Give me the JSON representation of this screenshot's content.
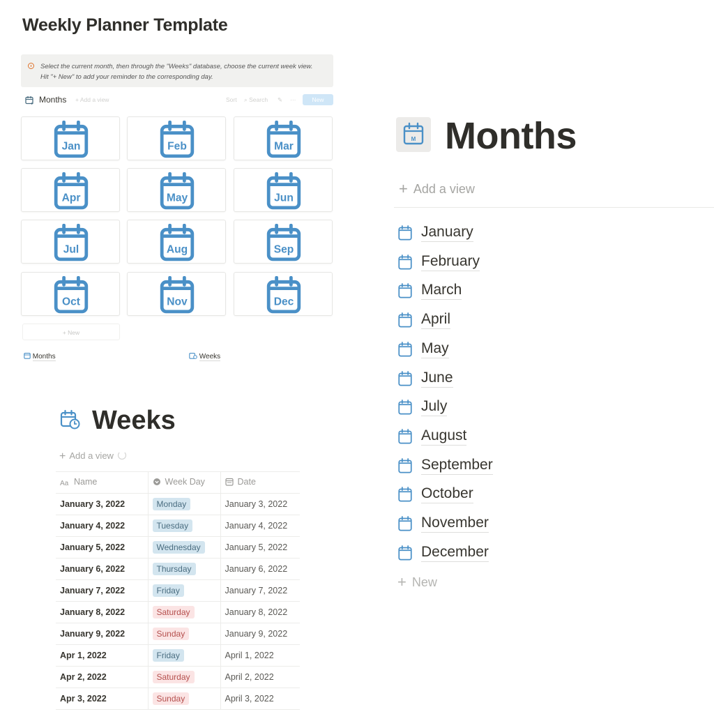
{
  "template": {
    "title": "Weekly Planner Template",
    "callout_line1": "Select the current month, then through the \"Weeks\" database, choose the current week view.",
    "callout_line2": "Hit \"+ New\" to add your reminder to the corresponding day.",
    "db_title": "Months",
    "db_add_view": "Add a view",
    "db_sort": "Sort",
    "db_search": "Search",
    "db_new": "New",
    "gallery": [
      "Jan",
      "Feb",
      "Mar",
      "Apr",
      "May",
      "Jun",
      "Jul",
      "Aug",
      "Sep",
      "Oct",
      "Nov",
      "Dec"
    ],
    "gallery_new": "+ New",
    "link_months": "Months",
    "link_weeks": "Weeks"
  },
  "months_page": {
    "title": "Months",
    "add_view": "Add a view",
    "items": [
      "January",
      "February",
      "March",
      "April",
      "May",
      "June",
      "July",
      "August",
      "September",
      "October",
      "November",
      "December"
    ],
    "new": "New"
  },
  "weeks_page": {
    "title": "Weeks",
    "add_view": "Add a view",
    "columns": [
      "Name",
      "Week Day",
      "Date"
    ],
    "rows": [
      {
        "name": "January 3, 2022",
        "day": "Monday",
        "color": "blue",
        "date": "January 3, 2022"
      },
      {
        "name": "January 4, 2022",
        "day": "Tuesday",
        "color": "blue",
        "date": "January 4, 2022"
      },
      {
        "name": "January 5, 2022",
        "day": "Wednesday",
        "color": "blue",
        "date": "January 5, 2022"
      },
      {
        "name": "January 6, 2022",
        "day": "Thursday",
        "color": "blue",
        "date": "January 6, 2022"
      },
      {
        "name": "January 7, 2022",
        "day": "Friday",
        "color": "blue",
        "date": "January 7, 2022"
      },
      {
        "name": "January 8, 2022",
        "day": "Saturday",
        "color": "red",
        "date": "January 8, 2022"
      },
      {
        "name": "January 9, 2022",
        "day": "Sunday",
        "color": "red",
        "date": "January 9, 2022"
      },
      {
        "name": "Apr 1, 2022",
        "day": "Friday",
        "color": "blue",
        "date": "April 1, 2022"
      },
      {
        "name": "Apr 2, 2022",
        "day": "Saturday",
        "color": "red",
        "date": "April 2, 2022"
      },
      {
        "name": "Apr 3, 2022",
        "day": "Sunday",
        "color": "red",
        "date": "April 3, 2022"
      }
    ]
  },
  "colors": {
    "calendar_icon": "#4a90c7",
    "tag_blue_bg": "#d3e5ef",
    "tag_red_bg": "#fbe4e4",
    "new_button": "#cfe6f7"
  }
}
